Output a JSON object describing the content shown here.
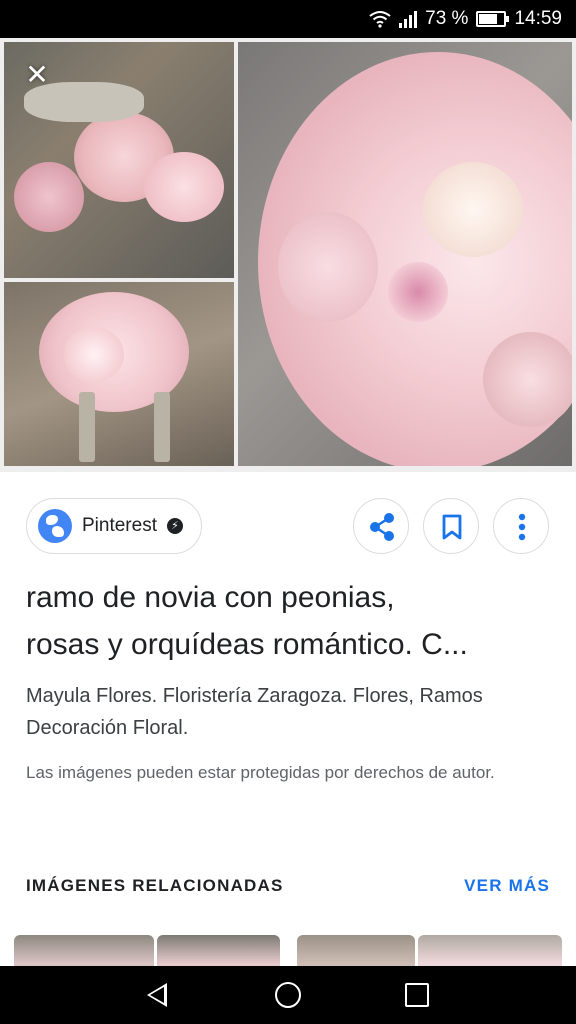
{
  "status_bar": {
    "battery_percent": "73 %",
    "battery_level": 0.73,
    "time": "14:59"
  },
  "viewer": {
    "close_icon": "close-icon"
  },
  "source": {
    "name": "Pinterest",
    "icon": "globe-icon",
    "badge_icon": "amp-lightning-icon"
  },
  "actions": [
    {
      "name": "share",
      "icon": "share-icon"
    },
    {
      "name": "save",
      "icon": "bookmark-icon"
    },
    {
      "name": "more",
      "icon": "more-vert-icon"
    }
  ],
  "result": {
    "title_line1": "ramo de novia con peonias,",
    "title_line2": "rosas y orquídeas romántico. C...",
    "description": "Mayula Flores. Floristería Zaragoza. Flores, Ramos Decoración Floral.",
    "copyright_notice": "Las imágenes pueden estar protegidas por derechos de autor."
  },
  "related": {
    "heading": "IMÁGENES RELACIONADAS",
    "more_label": "VER MÁS"
  },
  "colors": {
    "accent": "#1a73e8",
    "globe": "#4285f4",
    "icon_blue": "#1a73e8"
  }
}
